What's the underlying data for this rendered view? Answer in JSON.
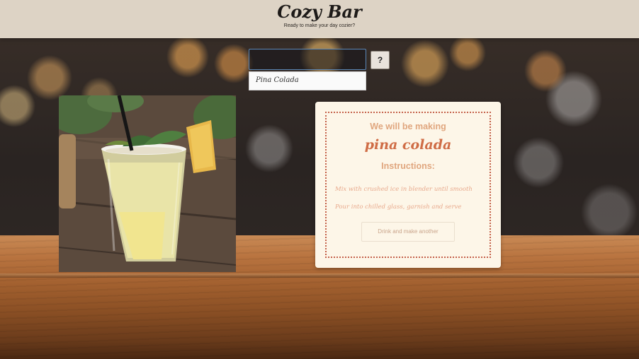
{
  "header": {
    "title": "Cozy Bar",
    "subtitle": "Ready to make your day cozier?"
  },
  "search": {
    "value": "",
    "placeholder": "",
    "help_label": "?",
    "suggestions": [
      "Pina Colada"
    ]
  },
  "recipe": {
    "making_label": "We will be making",
    "drink_name": "pina colada",
    "instructions_heading": "Instructions:",
    "steps": [
      "Mix with crushed ice in blender until smooth",
      "Pour into chilled glass, garnish and serve"
    ],
    "another_button_label": "Drink and make another"
  },
  "colors": {
    "accent": "#cf6c45",
    "label": "#e0a67e",
    "card_bg": "#fdf6e8"
  },
  "icons": {
    "help": "question-mark-icon"
  }
}
